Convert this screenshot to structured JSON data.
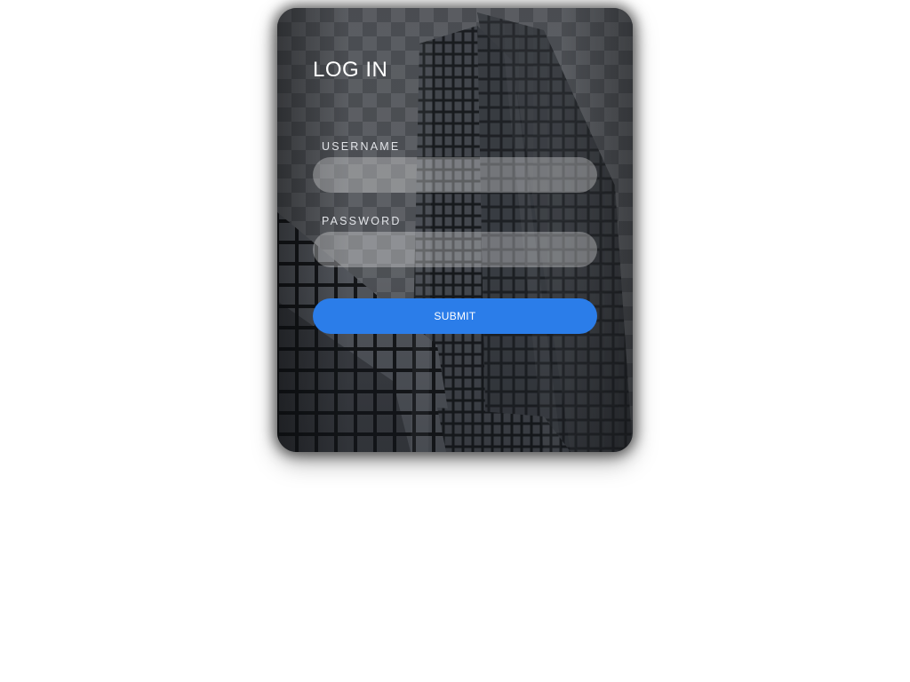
{
  "login": {
    "title": "LOG IN",
    "username_label": "USERNAME",
    "username_value": "",
    "password_label": "PASSWORD",
    "password_value": "",
    "submit_label": "SUBMIT"
  },
  "colors": {
    "accent": "#2b7de9",
    "card_tint": "#2b2e33",
    "text": "#ffffff"
  },
  "background_image": "skyscraper-glass-facade"
}
